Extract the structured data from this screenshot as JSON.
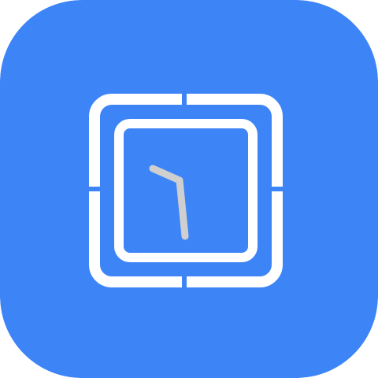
{
  "app_icon": {
    "icon_name": "square-clock-icon",
    "colors": {
      "background": "#3D84F7",
      "frame": "#FFFFFF",
      "hand": "#CFCFCF"
    }
  }
}
